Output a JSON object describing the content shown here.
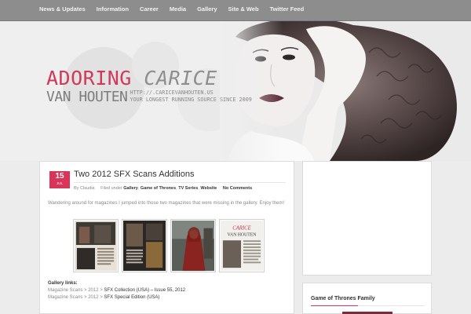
{
  "nav": {
    "items": [
      "News & Updates",
      "Information",
      "Career",
      "Media",
      "Gallery",
      "Site & Web",
      "Twitter Feed"
    ]
  },
  "header": {
    "logo_word1": "ADORING",
    "logo_word2": "CARICE",
    "logo_surname": "VAN HOUTEN",
    "url": "HTTP://.CARICEVANHOUTEN.US",
    "tagline": "YOUR LONGEST RUNNING SOURCE SINCE 2009"
  },
  "post": {
    "day": "15",
    "month": "JUL",
    "title": "Two 2012 SFX Scans Additions",
    "meta": {
      "by": "By",
      "author": "Claudia",
      "filed_label": "Filed under",
      "categories": [
        "Gallery",
        "Game of Thrones",
        "TV Series",
        "Website"
      ],
      "comments": "No Comments"
    },
    "excerpt": "Wandering around for magazines I jumped into those two magazines that were missing in the gallery. Enjoy them!",
    "thumb_text": "CARICE VAN HOUTEN",
    "links_header": "Gallery links:",
    "links": [
      {
        "a": "Magazine Scans",
        "b": "2012",
        "c": "SFX Collection (USA) – Issue 55, 2012"
      },
      {
        "a": "Magazine Scans",
        "b": "2012",
        "c": "SFX Special Edition (USA)"
      }
    ]
  },
  "sidebar": {
    "widget_title": "Game of Thrones Family"
  },
  "colors": {
    "accent": "#d9345a",
    "nav_bg": "#8d8d8d"
  }
}
